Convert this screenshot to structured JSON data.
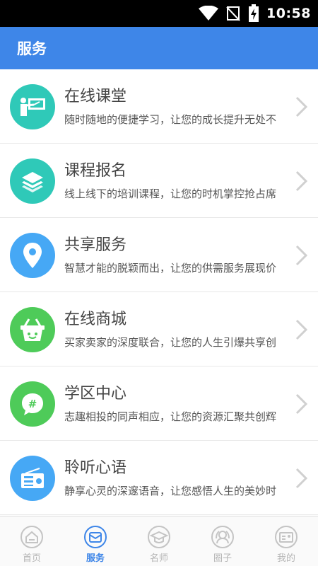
{
  "status_bar": {
    "time": "10:58"
  },
  "app_bar": {
    "title": "服务"
  },
  "services": [
    {
      "title": "在线课堂",
      "desc": "随时随地的便捷学习，让您的成长提升无处不",
      "color": "#2fc9b8",
      "icon": "teacher-board-icon"
    },
    {
      "title": "课程报名",
      "desc": "线上线下的培训课程，让您的时机掌控抢占席",
      "color": "#2fc9b8",
      "icon": "layers-icon"
    },
    {
      "title": "共享服务",
      "desc": "智慧才能的脱颖而出，让您的供需服务展现价",
      "color": "#46a8f5",
      "icon": "location-pin-icon"
    },
    {
      "title": "在线商城",
      "desc": "买家卖家的深度联合，让您的人生引爆共享创",
      "color": "#4ecb59",
      "icon": "shopping-basket-icon"
    },
    {
      "title": "学区中心",
      "desc": "志趣相投的同声相应，让您的资源汇聚共创辉",
      "color": "#4ecb59",
      "icon": "chat-hash-icon"
    },
    {
      "title": "聆听心语",
      "desc": "静享心灵的深邃语音，让您感悟人生的美妙时",
      "color": "#46a8f5",
      "icon": "radio-icon"
    }
  ],
  "tab_bar": {
    "active_color": "#3e86e8",
    "inactive_color": "#c4c4c4",
    "tabs": [
      {
        "label": "首页",
        "icon": "home-icon"
      },
      {
        "label": "服务",
        "icon": "service-icon",
        "active": true
      },
      {
        "label": "名师",
        "icon": "graduation-cap-icon"
      },
      {
        "label": "圈子",
        "icon": "circle-people-icon"
      },
      {
        "label": "我的",
        "icon": "profile-card-icon"
      }
    ]
  }
}
